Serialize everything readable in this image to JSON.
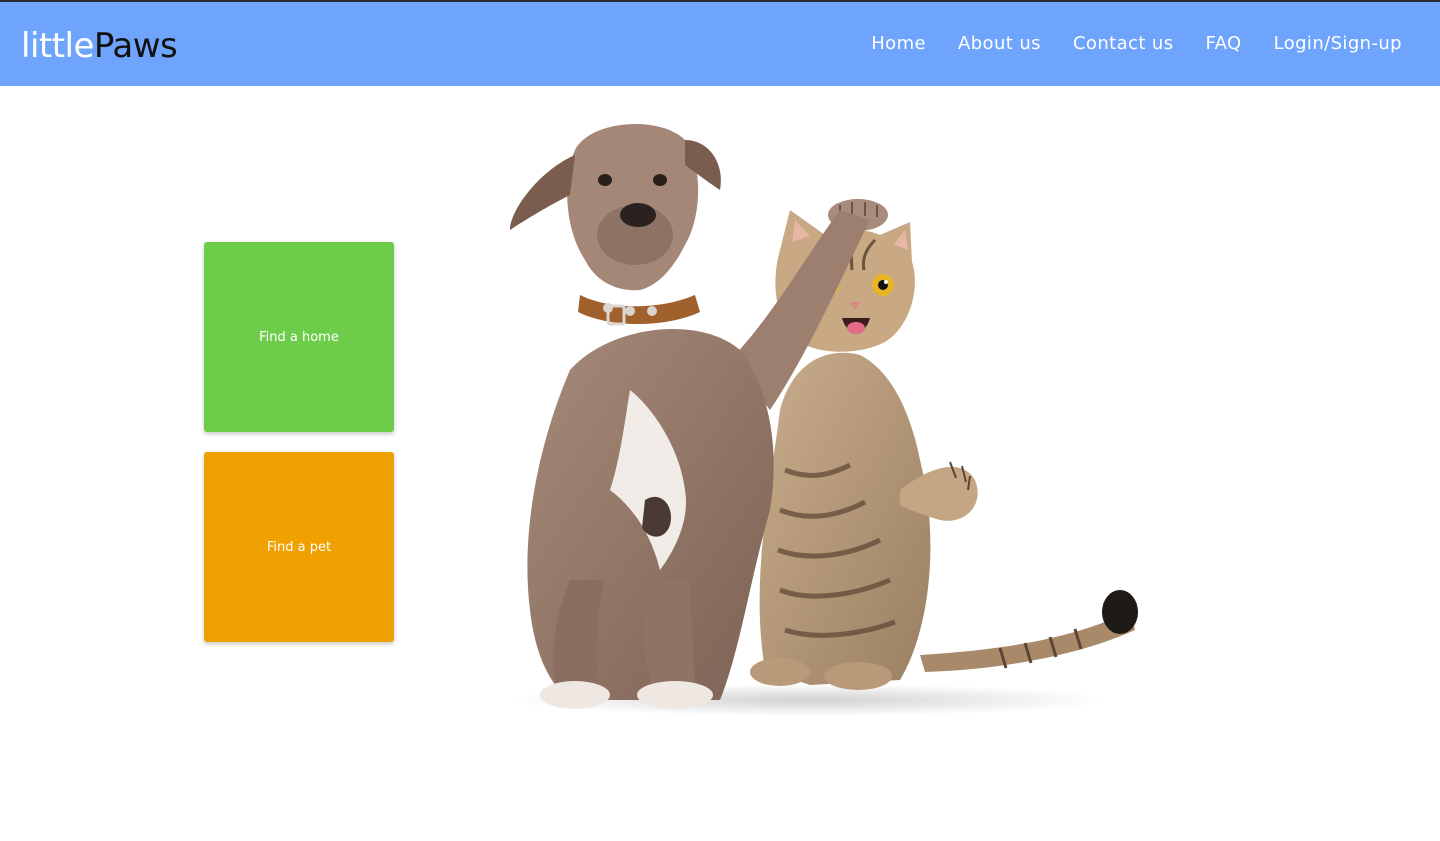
{
  "brand": {
    "part1": "little",
    "part2": "Paws"
  },
  "nav": {
    "items": [
      {
        "label": "Home"
      },
      {
        "label": "About us"
      },
      {
        "label": "Contact us"
      },
      {
        "label": "FAQ"
      },
      {
        "label": "Login/Sign-up"
      }
    ]
  },
  "tiles": {
    "find_home": {
      "label": "Find a home",
      "color": "#6dcc4a"
    },
    "find_pet": {
      "label": "Find a pet",
      "color": "#f0a000"
    }
  },
  "colors": {
    "navbar": "#6fa4fc",
    "brand_light": "#ffffff",
    "brand_dark": "#111111"
  },
  "hero": {
    "icon": "dog-and-cat-illustration"
  }
}
